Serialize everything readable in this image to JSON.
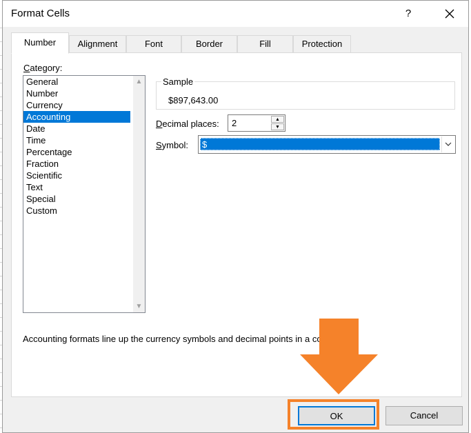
{
  "dialog": {
    "title": "Format Cells",
    "help_label": "?",
    "close_icon": "close-icon"
  },
  "tabs": [
    {
      "label": "Number",
      "active": true
    },
    {
      "label": "Alignment",
      "active": false
    },
    {
      "label": "Font",
      "active": false
    },
    {
      "label": "Border",
      "active": false
    },
    {
      "label": "Fill",
      "active": false
    },
    {
      "label": "Protection",
      "active": false
    }
  ],
  "category": {
    "label_prefix": "C",
    "label_rest": "ategory:",
    "items": [
      "General",
      "Number",
      "Currency",
      "Accounting",
      "Date",
      "Time",
      "Percentage",
      "Fraction",
      "Scientific",
      "Text",
      "Special",
      "Custom"
    ],
    "selected": "Accounting"
  },
  "sample": {
    "label": "Sample",
    "value": "$897,643.00"
  },
  "decimal_places": {
    "label_prefix": "D",
    "label_rest": "ecimal places:",
    "value": "2"
  },
  "symbol": {
    "label_prefix": "S",
    "label_rest": "ymbol:",
    "value": "$"
  },
  "description": "Accounting formats line up the currency symbols and decimal points in a column.",
  "buttons": {
    "ok": "OK",
    "cancel": "Cancel"
  },
  "colors": {
    "accent": "#0078d7",
    "highlight_arrow": "#f5822a"
  }
}
